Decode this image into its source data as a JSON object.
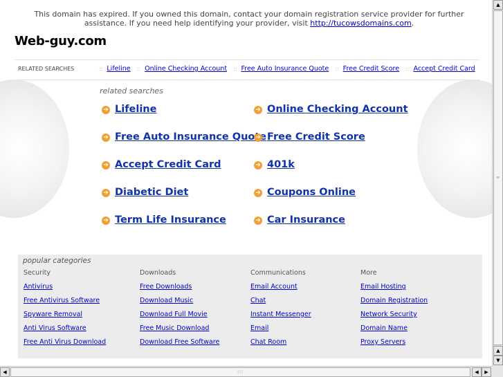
{
  "notice": {
    "text_before": "This domain has expired. If you owned this domain, contact your domain registration service provider for further assistance. If you need help identifying your provider, visit ",
    "link": "http://tucowsdomains.com",
    "text_after": "."
  },
  "site_title": "Web-guy.com",
  "related_bar": {
    "label": "RELATED SEARCHES",
    "separator": "::",
    "links": [
      "Lifeline",
      "Online Checking Account",
      "Free Auto Insurance Quote",
      "Free Credit Score",
      "Accept Credit Card"
    ]
  },
  "related_searches": {
    "heading": "related searches",
    "left": [
      "Lifeline",
      "Free Auto Insurance Quote",
      "Accept Credit Card",
      "Diabetic Diet",
      "Term Life Insurance"
    ],
    "right": [
      "Online Checking Account",
      "Free Credit Score",
      "401k",
      "Coupons Online",
      "Car Insurance"
    ]
  },
  "popular": {
    "heading": "popular categories",
    "columns": [
      {
        "title": "Security",
        "links": [
          "Antivirus",
          "Free Antivirus Software",
          "Spyware Removal",
          "Anti Virus Software",
          "Free Anti Virus Download"
        ]
      },
      {
        "title": "Downloads",
        "links": [
          "Free Downloads",
          "Download Music",
          "Download Full Movie",
          "Free Music Download",
          "Download Free Software"
        ]
      },
      {
        "title": "Communications",
        "links": [
          "Email Account",
          "Chat",
          "Instant Messenger",
          "Email",
          "Chat Room"
        ]
      },
      {
        "title": "More",
        "links": [
          "Email Hosting",
          "Domain Registration",
          "Network Security",
          "Domain Name",
          "Proxy Servers"
        ]
      }
    ]
  },
  "icons": {
    "arrow": "orange-arrow-circle-icon"
  },
  "colors": {
    "link": "#0000cc",
    "big_link": "#1133aa",
    "arrow": "#f0a030"
  }
}
